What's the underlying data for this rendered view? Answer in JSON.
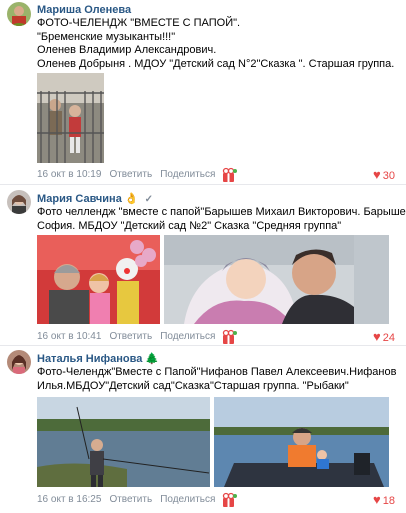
{
  "posts": [
    {
      "author": "Мариша Оленева",
      "lines": [
        "ФОТО-ЧЕЛЕНДЖ \"ВМЕСТЕ С ПАПОЙ\".",
        "\"Бременские музыканты!!!\"",
        "Оленев Владимир Александрович.",
        "Оленев Добрыня . МДОУ \"Детский сад N°2\"Сказка \". Старшая группа."
      ],
      "time": "16 окт в 10:19",
      "reply": "Ответить",
      "share": "Поделиться",
      "likes": "30"
    },
    {
      "author": "Мария Савчина",
      "author_emoji": "👌",
      "verified": "✓",
      "lines": [
        "Фото челлендж \"вместе с папой\"Барышев Михаил Викторович. Барышева",
        "София. МБДОУ \"Детский сад №2\" Сказка \"Средняя группа\""
      ],
      "time": "16 окт в 10:41",
      "reply": "Ответить",
      "share": "Поделиться",
      "likes": "24"
    },
    {
      "author": "Наталья Нифанова",
      "author_emoji": "🌲",
      "lines": [
        "Фото-Челендж\"Вместе с Папой\"Нифанов Павел Алексеевич.Нифанов",
        "Илья.МБДОУ\"Детский сад\"Сказка\"Старшая группа. \"Рыбаки\""
      ],
      "time": "16 окт в 16:25",
      "reply": "Ответить",
      "share": "Поделиться",
      "likes": "18"
    }
  ],
  "colors": {
    "link": "#2a5885",
    "meta": "#818c99",
    "like": "#e64646"
  },
  "icons": [
    "gift-icon",
    "heart-icon",
    "avatar"
  ]
}
